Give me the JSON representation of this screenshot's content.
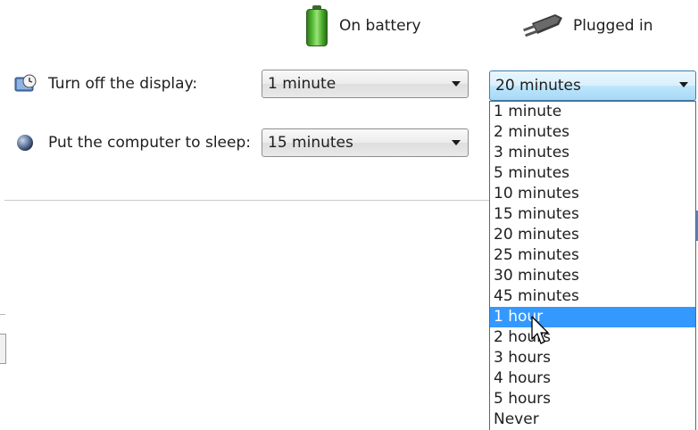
{
  "headers": {
    "battery_label": "On battery",
    "plugged_label": "Plugged in",
    "battery_icon": "battery-icon",
    "plugged_icon": "power-plug-icon"
  },
  "settings": {
    "display": {
      "label": "Turn off the display:",
      "icon": "display-clock-icon",
      "on_battery_value": "1 minute",
      "plugged_in_value": "20 minutes"
    },
    "sleep": {
      "label": "Put the computer to sleep:",
      "icon": "sleep-moon-icon",
      "on_battery_value": "15 minutes"
    }
  },
  "dropdown": {
    "open_for": "display.plugged_in",
    "highlighted_option": "1 hour",
    "options": [
      "1 minute",
      "2 minutes",
      "3 minutes",
      "5 minutes",
      "10 minutes",
      "15 minutes",
      "20 minutes",
      "25 minutes",
      "30 minutes",
      "45 minutes",
      "1 hour",
      "2 hours",
      "3 hours",
      "4 hours",
      "5 hours",
      "Never"
    ]
  },
  "colors": {
    "highlight": "#3399ff",
    "highlight_text": "#ffffff",
    "select_border_active": "#3c7fb1"
  }
}
